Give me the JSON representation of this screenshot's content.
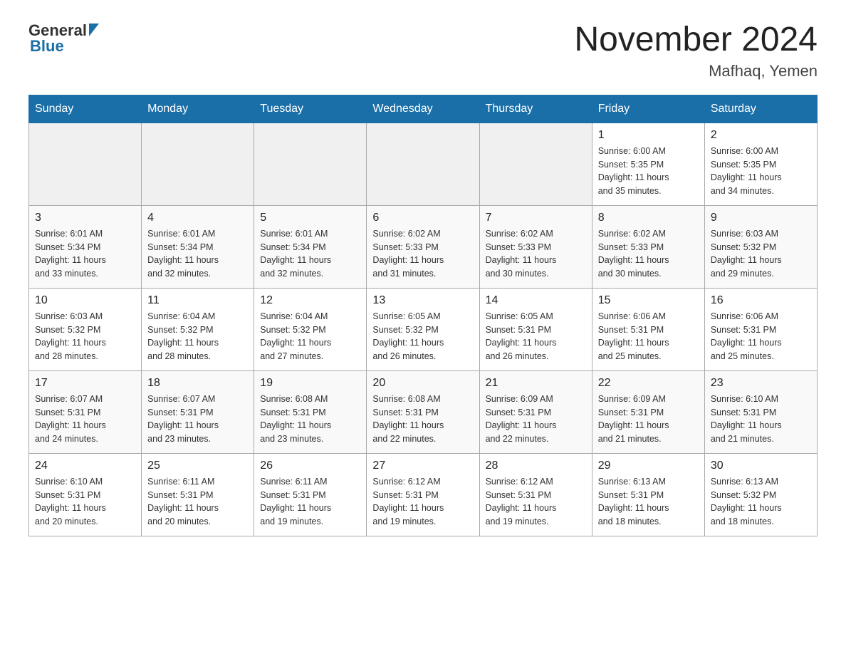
{
  "header": {
    "logo_general": "General",
    "logo_blue": "Blue",
    "month_title": "November 2024",
    "location": "Mafhaq, Yemen"
  },
  "calendar": {
    "days_of_week": [
      "Sunday",
      "Monday",
      "Tuesday",
      "Wednesday",
      "Thursday",
      "Friday",
      "Saturday"
    ],
    "weeks": [
      {
        "cells": [
          {
            "day": "",
            "info": ""
          },
          {
            "day": "",
            "info": ""
          },
          {
            "day": "",
            "info": ""
          },
          {
            "day": "",
            "info": ""
          },
          {
            "day": "",
            "info": ""
          },
          {
            "day": "1",
            "info": "Sunrise: 6:00 AM\nSunset: 5:35 PM\nDaylight: 11 hours\nand 35 minutes."
          },
          {
            "day": "2",
            "info": "Sunrise: 6:00 AM\nSunset: 5:35 PM\nDaylight: 11 hours\nand 34 minutes."
          }
        ]
      },
      {
        "cells": [
          {
            "day": "3",
            "info": "Sunrise: 6:01 AM\nSunset: 5:34 PM\nDaylight: 11 hours\nand 33 minutes."
          },
          {
            "day": "4",
            "info": "Sunrise: 6:01 AM\nSunset: 5:34 PM\nDaylight: 11 hours\nand 32 minutes."
          },
          {
            "day": "5",
            "info": "Sunrise: 6:01 AM\nSunset: 5:34 PM\nDaylight: 11 hours\nand 32 minutes."
          },
          {
            "day": "6",
            "info": "Sunrise: 6:02 AM\nSunset: 5:33 PM\nDaylight: 11 hours\nand 31 minutes."
          },
          {
            "day": "7",
            "info": "Sunrise: 6:02 AM\nSunset: 5:33 PM\nDaylight: 11 hours\nand 30 minutes."
          },
          {
            "day": "8",
            "info": "Sunrise: 6:02 AM\nSunset: 5:33 PM\nDaylight: 11 hours\nand 30 minutes."
          },
          {
            "day": "9",
            "info": "Sunrise: 6:03 AM\nSunset: 5:32 PM\nDaylight: 11 hours\nand 29 minutes."
          }
        ]
      },
      {
        "cells": [
          {
            "day": "10",
            "info": "Sunrise: 6:03 AM\nSunset: 5:32 PM\nDaylight: 11 hours\nand 28 minutes."
          },
          {
            "day": "11",
            "info": "Sunrise: 6:04 AM\nSunset: 5:32 PM\nDaylight: 11 hours\nand 28 minutes."
          },
          {
            "day": "12",
            "info": "Sunrise: 6:04 AM\nSunset: 5:32 PM\nDaylight: 11 hours\nand 27 minutes."
          },
          {
            "day": "13",
            "info": "Sunrise: 6:05 AM\nSunset: 5:32 PM\nDaylight: 11 hours\nand 26 minutes."
          },
          {
            "day": "14",
            "info": "Sunrise: 6:05 AM\nSunset: 5:31 PM\nDaylight: 11 hours\nand 26 minutes."
          },
          {
            "day": "15",
            "info": "Sunrise: 6:06 AM\nSunset: 5:31 PM\nDaylight: 11 hours\nand 25 minutes."
          },
          {
            "day": "16",
            "info": "Sunrise: 6:06 AM\nSunset: 5:31 PM\nDaylight: 11 hours\nand 25 minutes."
          }
        ]
      },
      {
        "cells": [
          {
            "day": "17",
            "info": "Sunrise: 6:07 AM\nSunset: 5:31 PM\nDaylight: 11 hours\nand 24 minutes."
          },
          {
            "day": "18",
            "info": "Sunrise: 6:07 AM\nSunset: 5:31 PM\nDaylight: 11 hours\nand 23 minutes."
          },
          {
            "day": "19",
            "info": "Sunrise: 6:08 AM\nSunset: 5:31 PM\nDaylight: 11 hours\nand 23 minutes."
          },
          {
            "day": "20",
            "info": "Sunrise: 6:08 AM\nSunset: 5:31 PM\nDaylight: 11 hours\nand 22 minutes."
          },
          {
            "day": "21",
            "info": "Sunrise: 6:09 AM\nSunset: 5:31 PM\nDaylight: 11 hours\nand 22 minutes."
          },
          {
            "day": "22",
            "info": "Sunrise: 6:09 AM\nSunset: 5:31 PM\nDaylight: 11 hours\nand 21 minutes."
          },
          {
            "day": "23",
            "info": "Sunrise: 6:10 AM\nSunset: 5:31 PM\nDaylight: 11 hours\nand 21 minutes."
          }
        ]
      },
      {
        "cells": [
          {
            "day": "24",
            "info": "Sunrise: 6:10 AM\nSunset: 5:31 PM\nDaylight: 11 hours\nand 20 minutes."
          },
          {
            "day": "25",
            "info": "Sunrise: 6:11 AM\nSunset: 5:31 PM\nDaylight: 11 hours\nand 20 minutes."
          },
          {
            "day": "26",
            "info": "Sunrise: 6:11 AM\nSunset: 5:31 PM\nDaylight: 11 hours\nand 19 minutes."
          },
          {
            "day": "27",
            "info": "Sunrise: 6:12 AM\nSunset: 5:31 PM\nDaylight: 11 hours\nand 19 minutes."
          },
          {
            "day": "28",
            "info": "Sunrise: 6:12 AM\nSunset: 5:31 PM\nDaylight: 11 hours\nand 19 minutes."
          },
          {
            "day": "29",
            "info": "Sunrise: 6:13 AM\nSunset: 5:31 PM\nDaylight: 11 hours\nand 18 minutes."
          },
          {
            "day": "30",
            "info": "Sunrise: 6:13 AM\nSunset: 5:32 PM\nDaylight: 11 hours\nand 18 minutes."
          }
        ]
      }
    ]
  }
}
